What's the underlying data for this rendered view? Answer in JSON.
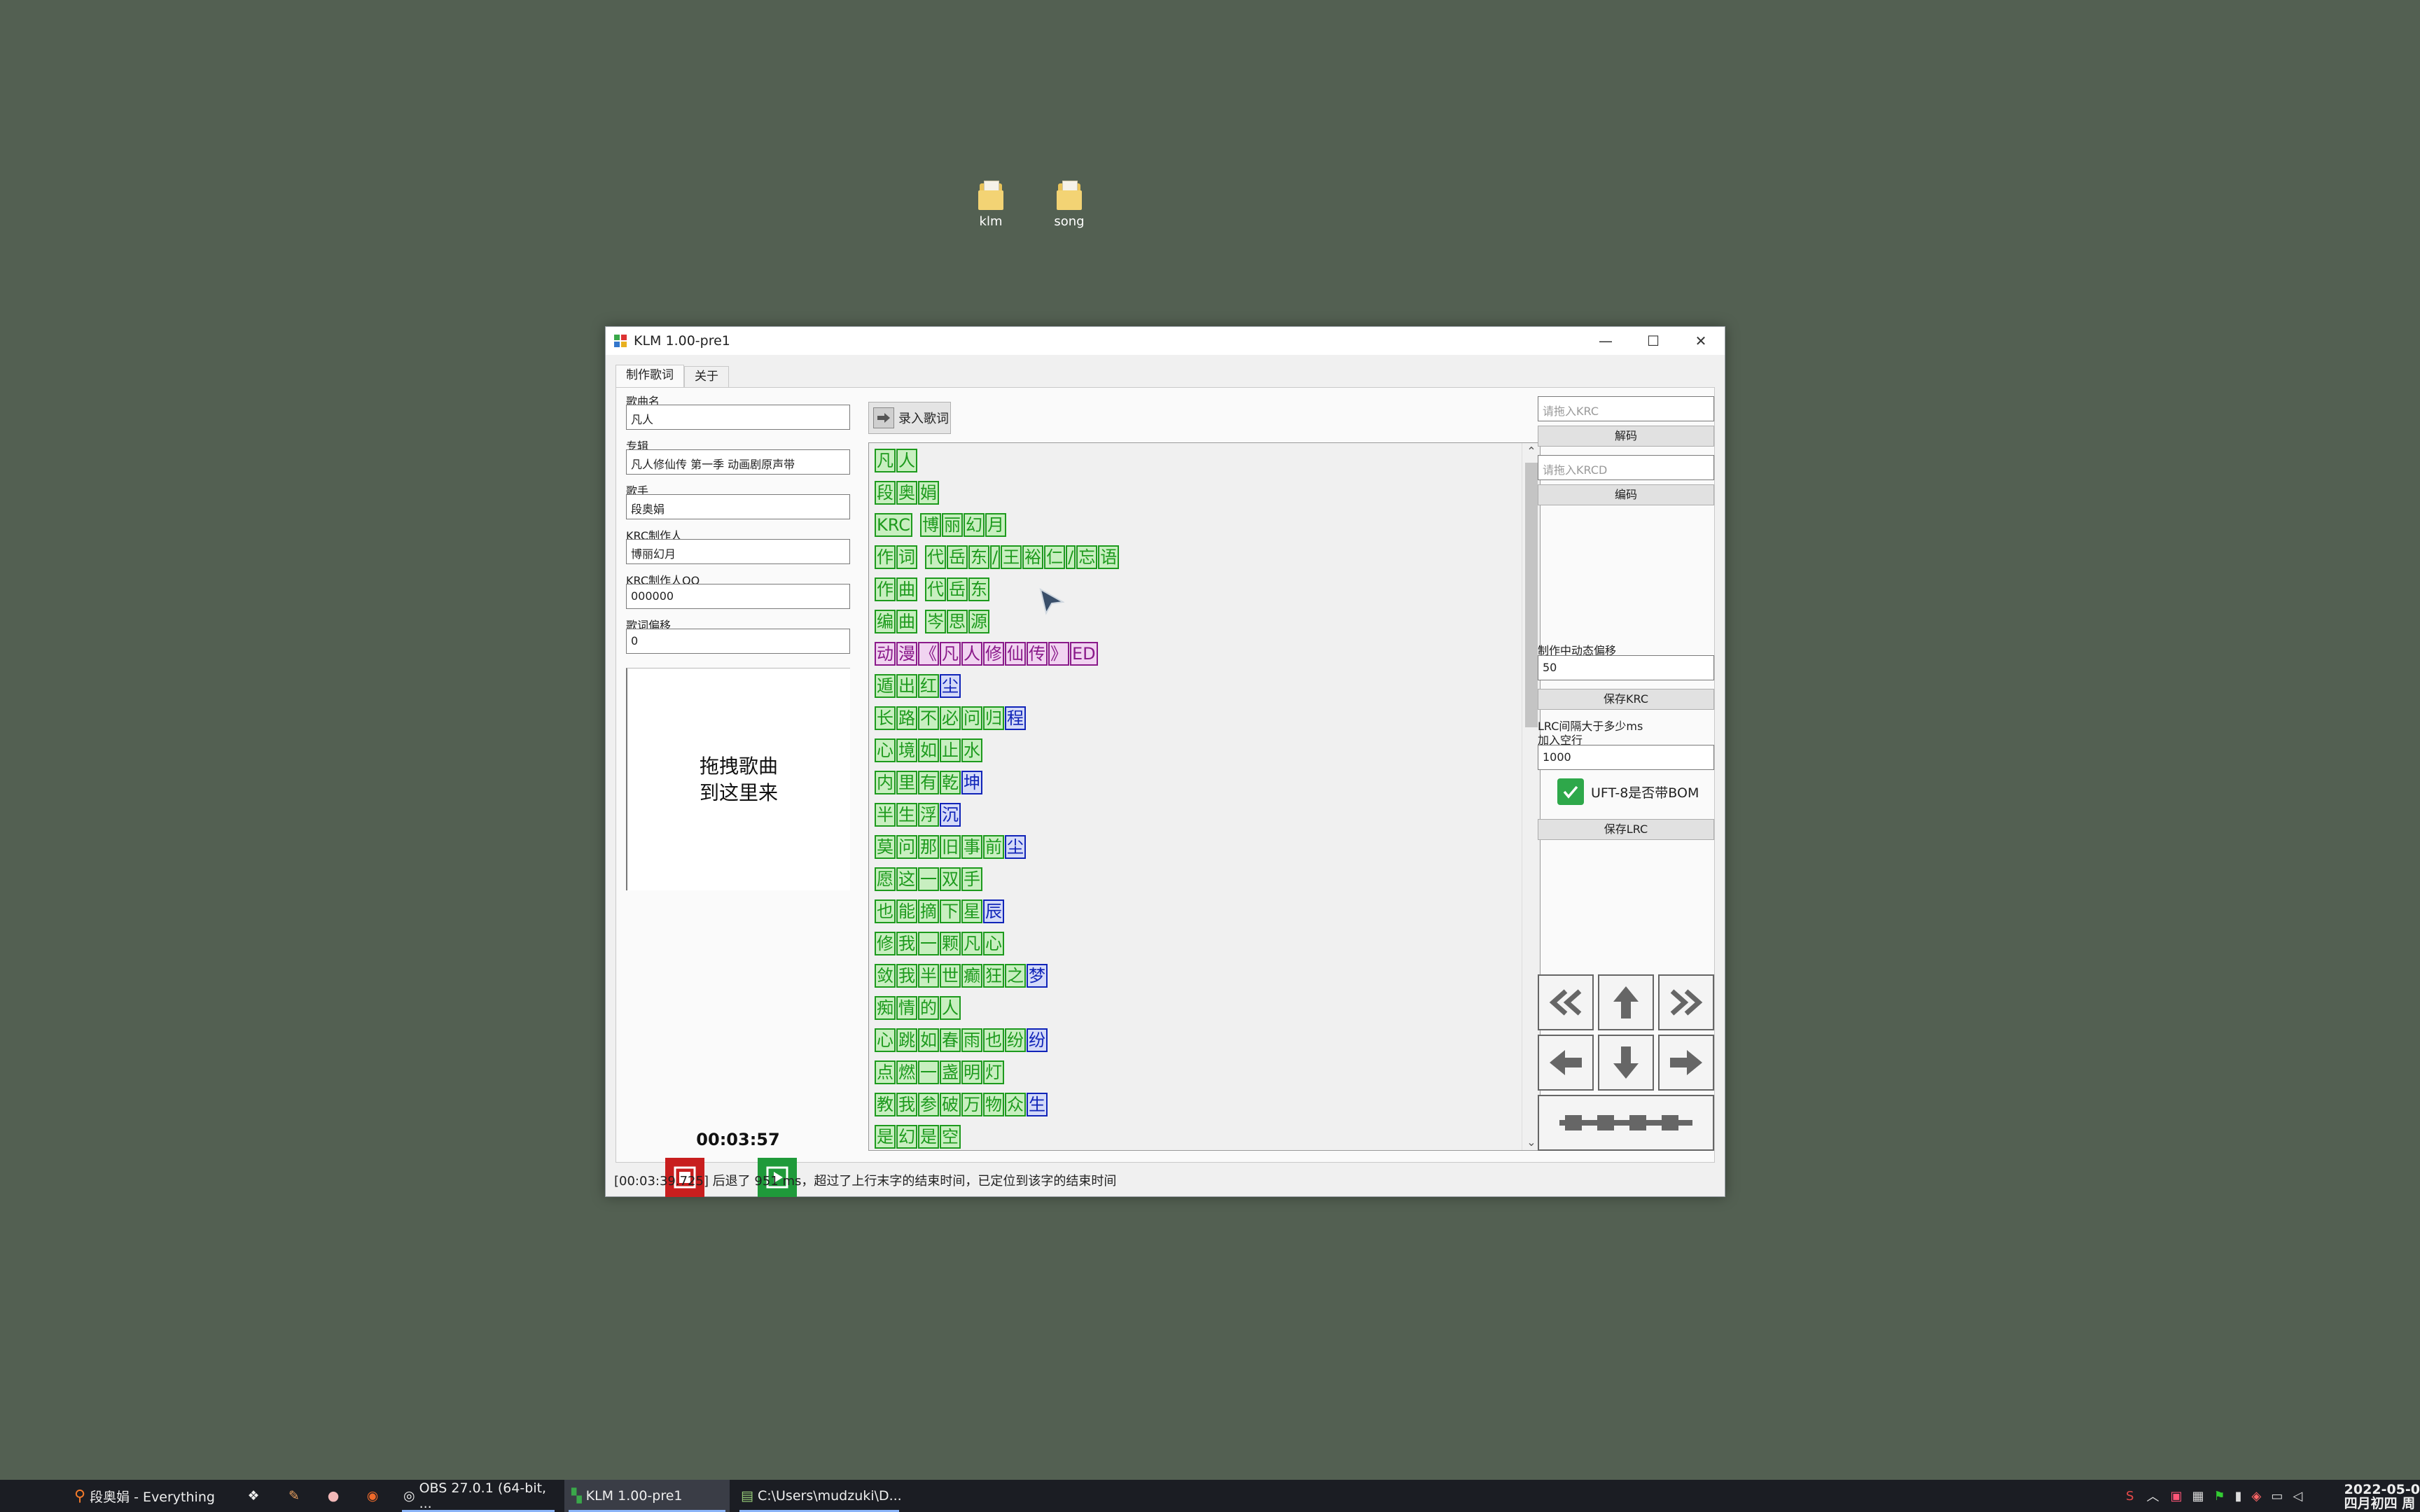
{
  "desktop": {
    "icons": [
      {
        "name": "klm"
      },
      {
        "name": "song"
      }
    ]
  },
  "window": {
    "title": "KLM 1.00-pre1",
    "controls": {
      "minimize": "—",
      "maximize": "☐",
      "close": "✕"
    },
    "tabs": [
      {
        "label": "制作歌词",
        "active": true
      },
      {
        "label": "关于",
        "active": false
      }
    ]
  },
  "left": {
    "fields": [
      {
        "label": "歌曲名",
        "value": "凡人"
      },
      {
        "label": "专辑",
        "value": "凡人修仙传 第一季 动画剧原声带"
      },
      {
        "label": "歌手",
        "value": "段奥娟"
      },
      {
        "label": "KRC制作人",
        "value": "博丽幻月"
      },
      {
        "label": "KRC制作人QQ",
        "value": "000000"
      },
      {
        "label": "歌词偏移",
        "value": "0"
      }
    ],
    "drop_line1": "拖拽歌曲",
    "drop_line2": "到这里来",
    "time": "00:03:57"
  },
  "center": {
    "input_lyrics_label": "录入歌词",
    "lines": [
      [
        {
          "t": "凡",
          "c": "g"
        },
        {
          "t": "人",
          "c": "g"
        }
      ],
      [
        {
          "t": "段",
          "c": "g"
        },
        {
          "t": "奥",
          "c": "g"
        },
        {
          "t": "娟",
          "c": "g"
        }
      ],
      [
        {
          "t": "KRC",
          "c": "g"
        },
        {
          "t": " ",
          "c": "s"
        },
        {
          "t": "博",
          "c": "g"
        },
        {
          "t": "丽",
          "c": "g"
        },
        {
          "t": "幻",
          "c": "g"
        },
        {
          "t": "月",
          "c": "g"
        }
      ],
      [
        {
          "t": "作",
          "c": "g"
        },
        {
          "t": "词",
          "c": "g"
        },
        {
          "t": " ",
          "c": "s"
        },
        {
          "t": "代",
          "c": "g"
        },
        {
          "t": "岳",
          "c": "g"
        },
        {
          "t": "东",
          "c": "g"
        },
        {
          "t": "/",
          "c": "g"
        },
        {
          "t": "王",
          "c": "g"
        },
        {
          "t": "裕",
          "c": "g"
        },
        {
          "t": "仁",
          "c": "g"
        },
        {
          "t": "/",
          "c": "g"
        },
        {
          "t": "忘",
          "c": "g"
        },
        {
          "t": "语",
          "c": "g"
        }
      ],
      [
        {
          "t": "作",
          "c": "g"
        },
        {
          "t": "曲",
          "c": "g"
        },
        {
          "t": " ",
          "c": "s"
        },
        {
          "t": "代",
          "c": "g"
        },
        {
          "t": "岳",
          "c": "g"
        },
        {
          "t": "东",
          "c": "g"
        }
      ],
      [
        {
          "t": "编",
          "c": "g"
        },
        {
          "t": "曲",
          "c": "g"
        },
        {
          "t": " ",
          "c": "s"
        },
        {
          "t": "岑",
          "c": "g"
        },
        {
          "t": "思",
          "c": "g"
        },
        {
          "t": "源",
          "c": "g"
        }
      ],
      [
        {
          "t": "动",
          "c": "p"
        },
        {
          "t": "漫",
          "c": "p"
        },
        {
          "t": "《",
          "c": "p"
        },
        {
          "t": "凡",
          "c": "p"
        },
        {
          "t": "人",
          "c": "p"
        },
        {
          "t": "修",
          "c": "p"
        },
        {
          "t": "仙",
          "c": "p"
        },
        {
          "t": "传",
          "c": "p"
        },
        {
          "t": "》",
          "c": "p"
        },
        {
          "t": "ED",
          "c": "p"
        }
      ],
      [
        {
          "t": "遁",
          "c": "g"
        },
        {
          "t": "出",
          "c": "g"
        },
        {
          "t": "红",
          "c": "g"
        },
        {
          "t": "尘",
          "c": "b"
        }
      ],
      [
        {
          "t": "长",
          "c": "g"
        },
        {
          "t": "路",
          "c": "g"
        },
        {
          "t": "不",
          "c": "g"
        },
        {
          "t": "必",
          "c": "g"
        },
        {
          "t": "问",
          "c": "g"
        },
        {
          "t": "归",
          "c": "g"
        },
        {
          "t": "程",
          "c": "b"
        }
      ],
      [
        {
          "t": "心",
          "c": "g"
        },
        {
          "t": "境",
          "c": "g"
        },
        {
          "t": "如",
          "c": "g"
        },
        {
          "t": "止",
          "c": "g"
        },
        {
          "t": "水",
          "c": "g"
        }
      ],
      [
        {
          "t": "内",
          "c": "g"
        },
        {
          "t": "里",
          "c": "g"
        },
        {
          "t": "有",
          "c": "g"
        },
        {
          "t": "乾",
          "c": "g"
        },
        {
          "t": "坤",
          "c": "b"
        }
      ],
      [
        {
          "t": "半",
          "c": "g"
        },
        {
          "t": "生",
          "c": "g"
        },
        {
          "t": "浮",
          "c": "g"
        },
        {
          "t": "沉",
          "c": "b"
        }
      ],
      [
        {
          "t": "莫",
          "c": "g"
        },
        {
          "t": "问",
          "c": "g"
        },
        {
          "t": "那",
          "c": "g"
        },
        {
          "t": "旧",
          "c": "g"
        },
        {
          "t": "事",
          "c": "g"
        },
        {
          "t": "前",
          "c": "g"
        },
        {
          "t": "尘",
          "c": "b"
        }
      ],
      [
        {
          "t": "愿",
          "c": "g"
        },
        {
          "t": "这",
          "c": "g"
        },
        {
          "t": "一",
          "c": "g"
        },
        {
          "t": "双",
          "c": "g"
        },
        {
          "t": "手",
          "c": "g"
        }
      ],
      [
        {
          "t": "也",
          "c": "g"
        },
        {
          "t": "能",
          "c": "g"
        },
        {
          "t": "摘",
          "c": "g"
        },
        {
          "t": "下",
          "c": "g"
        },
        {
          "t": "星",
          "c": "g"
        },
        {
          "t": "辰",
          "c": "b"
        }
      ],
      [
        {
          "t": "修",
          "c": "g"
        },
        {
          "t": "我",
          "c": "g"
        },
        {
          "t": "一",
          "c": "g"
        },
        {
          "t": "颗",
          "c": "g"
        },
        {
          "t": "凡",
          "c": "g"
        },
        {
          "t": "心",
          "c": "g"
        }
      ],
      [
        {
          "t": "敛",
          "c": "g"
        },
        {
          "t": "我",
          "c": "g"
        },
        {
          "t": "半",
          "c": "g"
        },
        {
          "t": "世",
          "c": "g"
        },
        {
          "t": "癫",
          "c": "g"
        },
        {
          "t": "狂",
          "c": "g"
        },
        {
          "t": "之",
          "c": "g"
        },
        {
          "t": "梦",
          "c": "b"
        }
      ],
      [
        {
          "t": "痴",
          "c": "g"
        },
        {
          "t": "情",
          "c": "g"
        },
        {
          "t": "的",
          "c": "g"
        },
        {
          "t": "人",
          "c": "g"
        }
      ],
      [
        {
          "t": "心",
          "c": "g"
        },
        {
          "t": "跳",
          "c": "g"
        },
        {
          "t": "如",
          "c": "g"
        },
        {
          "t": "春",
          "c": "g"
        },
        {
          "t": "雨",
          "c": "g"
        },
        {
          "t": "也",
          "c": "g"
        },
        {
          "t": "纷",
          "c": "g"
        },
        {
          "t": "纷",
          "c": "b"
        }
      ],
      [
        {
          "t": "点",
          "c": "g"
        },
        {
          "t": "燃",
          "c": "g"
        },
        {
          "t": "一",
          "c": "g"
        },
        {
          "t": "盏",
          "c": "g"
        },
        {
          "t": "明",
          "c": "g"
        },
        {
          "t": "灯",
          "c": "g"
        }
      ],
      [
        {
          "t": "教",
          "c": "g"
        },
        {
          "t": "我",
          "c": "g"
        },
        {
          "t": "参",
          "c": "g"
        },
        {
          "t": "破",
          "c": "g"
        },
        {
          "t": "万",
          "c": "g"
        },
        {
          "t": "物",
          "c": "g"
        },
        {
          "t": "众",
          "c": "g"
        },
        {
          "t": "生",
          "c": "b"
        }
      ],
      [
        {
          "t": "是",
          "c": "g"
        },
        {
          "t": "幻",
          "c": "g"
        },
        {
          "t": "是",
          "c": "g"
        },
        {
          "t": "空",
          "c": "g"
        }
      ]
    ]
  },
  "right": {
    "krc_placeholder": "请拖入KRC",
    "decode_label": "解码",
    "krcd_placeholder": "请拖入KRCD",
    "encode_label": "编码",
    "offset_label": "制作中动态偏移",
    "offset_value": "50",
    "save_krc_label": "保存KRC",
    "lrc_gap_label1": "LRC间隔大于多少ms",
    "lrc_gap_label2": "加入空行",
    "lrc_gap_value": "1000",
    "bom_label": "UFT-8是否带BOM",
    "bom_checked": true,
    "save_lrc_label": "保存LRC"
  },
  "status": "[00:03:39.725] 后退了 951 ms，超过了上行末字的结束时间，已定位到该字的结束时间",
  "taskbar": {
    "items": [
      {
        "label": "段奥娟 - Everything"
      },
      {
        "label": "OBS 27.0.1 (64-bit, ..."
      },
      {
        "label": "KLM 1.00-pre1"
      },
      {
        "label": "C:\\Users\\mudzuki\\D..."
      }
    ],
    "clock_line1": "2022-05-0",
    "clock_line2": "四月初四 周"
  },
  "colors": {
    "green": "#1d9a1d",
    "blue": "#1024b8",
    "purple": "#8a1a8a",
    "stop": "#c81e1e",
    "play": "#1f9a3a"
  }
}
